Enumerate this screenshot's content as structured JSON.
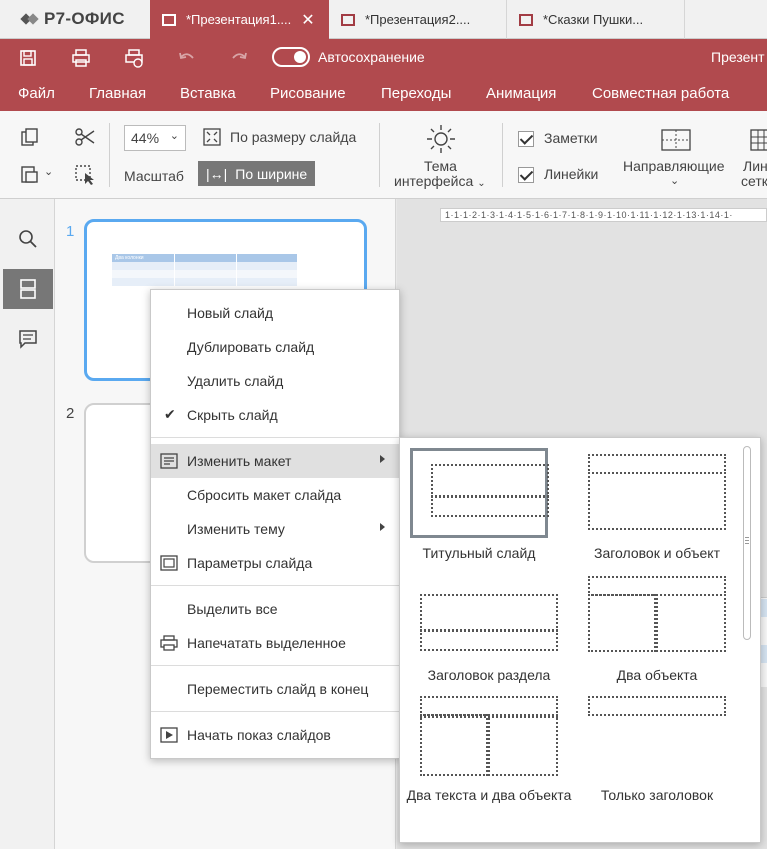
{
  "app": {
    "logo": "Р7-ОФИС"
  },
  "tabs": [
    {
      "label": "*Презентация1....",
      "active": true
    },
    {
      "label": "*Презентация2....",
      "active": false
    },
    {
      "label": "*Сказки Пушки...",
      "active": false
    }
  ],
  "titlebar": {
    "autosave_label": "Автосохранение",
    "doc_title": "Презент"
  },
  "menu": [
    "Файл",
    "Главная",
    "Вставка",
    "Рисование",
    "Переходы",
    "Анимация",
    "Совместная работа"
  ],
  "toolbar": {
    "zoom_value": "44%",
    "zoom_label": "Масштаб",
    "fit_slide": "По размеру слайда",
    "fit_width": "По ширине",
    "theme_line1": "Тема",
    "theme_line2": "интерфейса",
    "notes": "Заметки",
    "rulers": "Линейки",
    "guides": "Направляющие",
    "grid_line1": "Лин",
    "grid_line2": "сетк"
  },
  "slides": [
    "1",
    "2"
  ],
  "ruler_text": "1·1·1·2·1·3·1·4·1·5·1·6·1·7·1·8·1·9·1·10·1·11·1·12·1·13·1·14·1·",
  "thumb_table": {
    "header": "Два   колонки"
  },
  "context_menu": {
    "items": [
      "Новый слайд",
      "Дублировать слайд",
      "Удалить слайд",
      "Скрыть слайд",
      "Изменить макет",
      "Сбросить макет слайда",
      "Изменить тему",
      "Параметры слайда",
      "Выделить все",
      "Напечатать выделенное",
      "Переместить слайд в конец",
      "Начать показ слайдов"
    ]
  },
  "layouts": [
    {
      "label": "Титульный слайд"
    },
    {
      "label": "Заголовок и объект"
    },
    {
      "label": "Заголовок раздела"
    },
    {
      "label": "Два объекта"
    },
    {
      "label": "Два текста и два объекта"
    },
    {
      "label": "Только заголовок"
    }
  ],
  "colors": {
    "brand": "#b14a4e",
    "selected_thumb": "#5aa9f0"
  }
}
